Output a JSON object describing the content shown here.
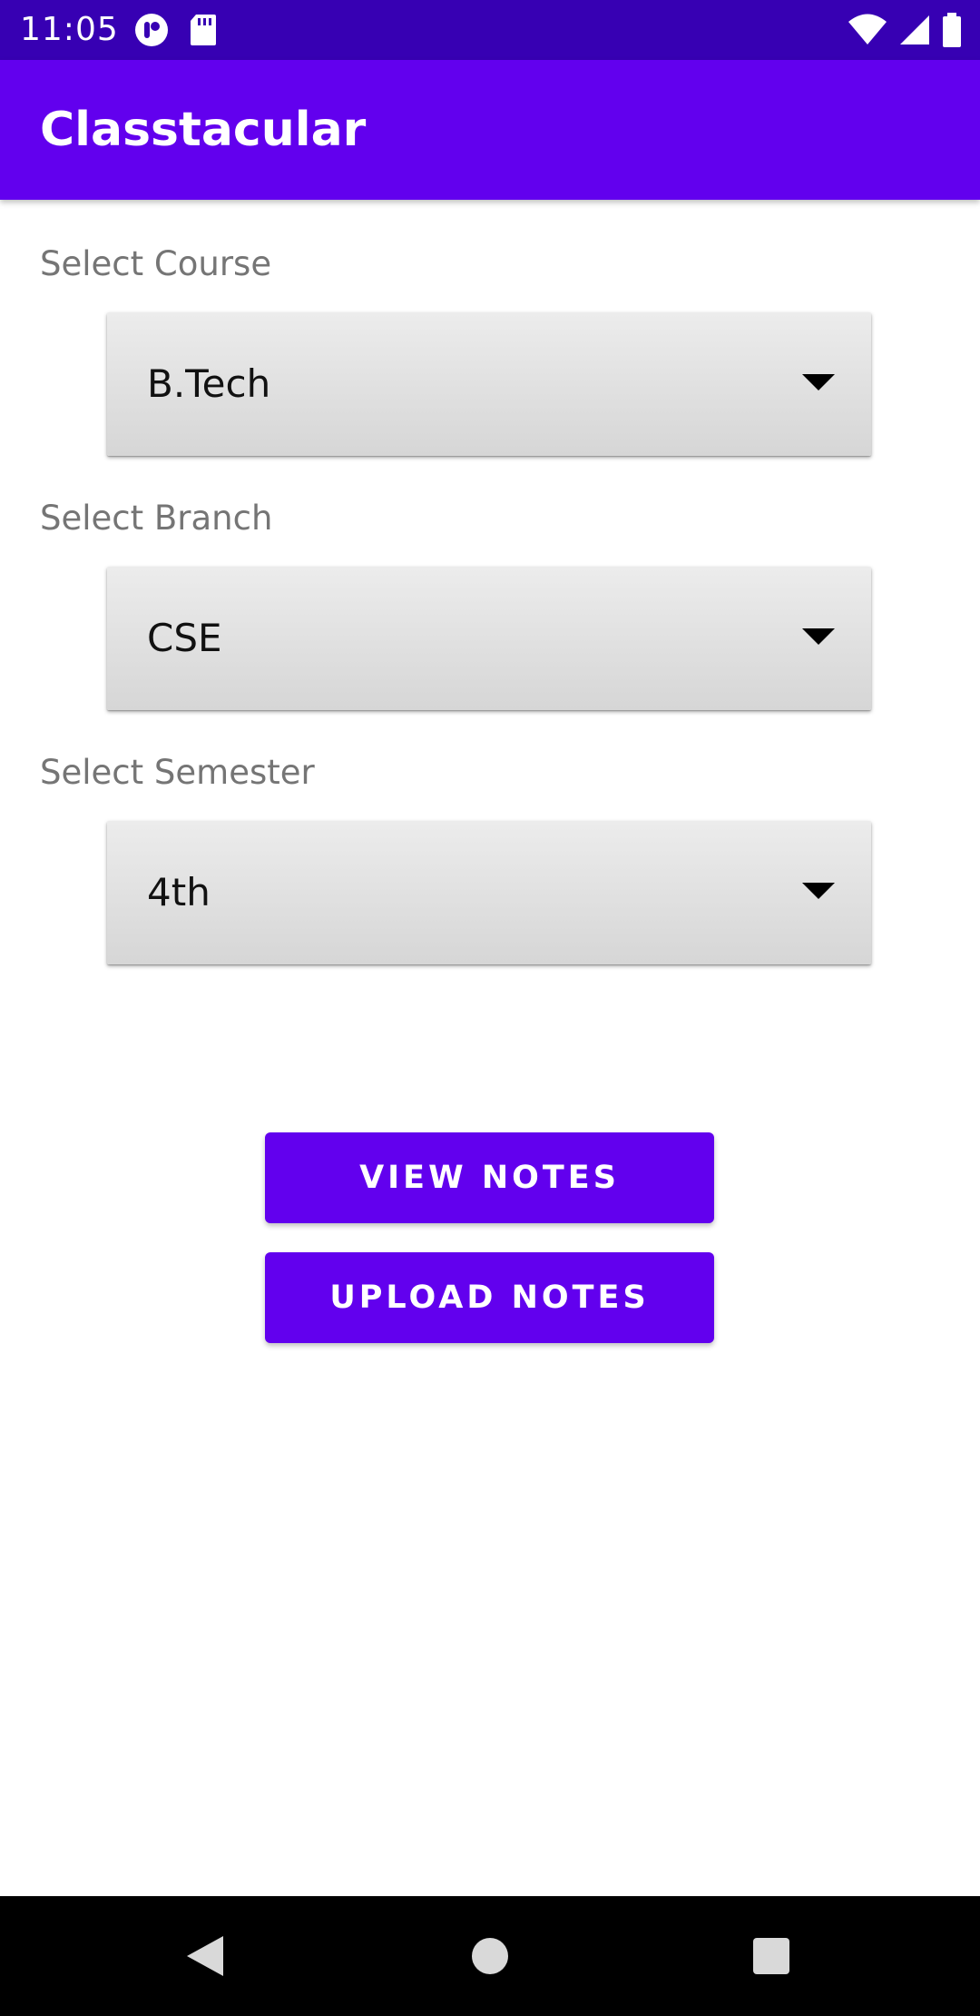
{
  "status_bar": {
    "time": "11:05",
    "left_icons": [
      "record-icon",
      "sd-card-icon"
    ],
    "right_icons": [
      "wifi-icon",
      "signal-icon",
      "battery-icon"
    ]
  },
  "app_bar": {
    "title": "Classtacular"
  },
  "form": {
    "course": {
      "label": "Select Course",
      "value": "B.Tech"
    },
    "branch": {
      "label": "Select Branch",
      "value": "CSE"
    },
    "semester": {
      "label": "Select Semester",
      "value": "4th"
    }
  },
  "actions": {
    "view_notes": "VIEW NOTES",
    "upload_notes": "UPLOAD NOTES"
  },
  "nav_bar": {
    "icons": [
      "back-icon",
      "home-icon",
      "recents-icon"
    ]
  },
  "colors": {
    "status_bar": "#3700b3",
    "primary": "#6200ee",
    "label_text": "#757575"
  }
}
